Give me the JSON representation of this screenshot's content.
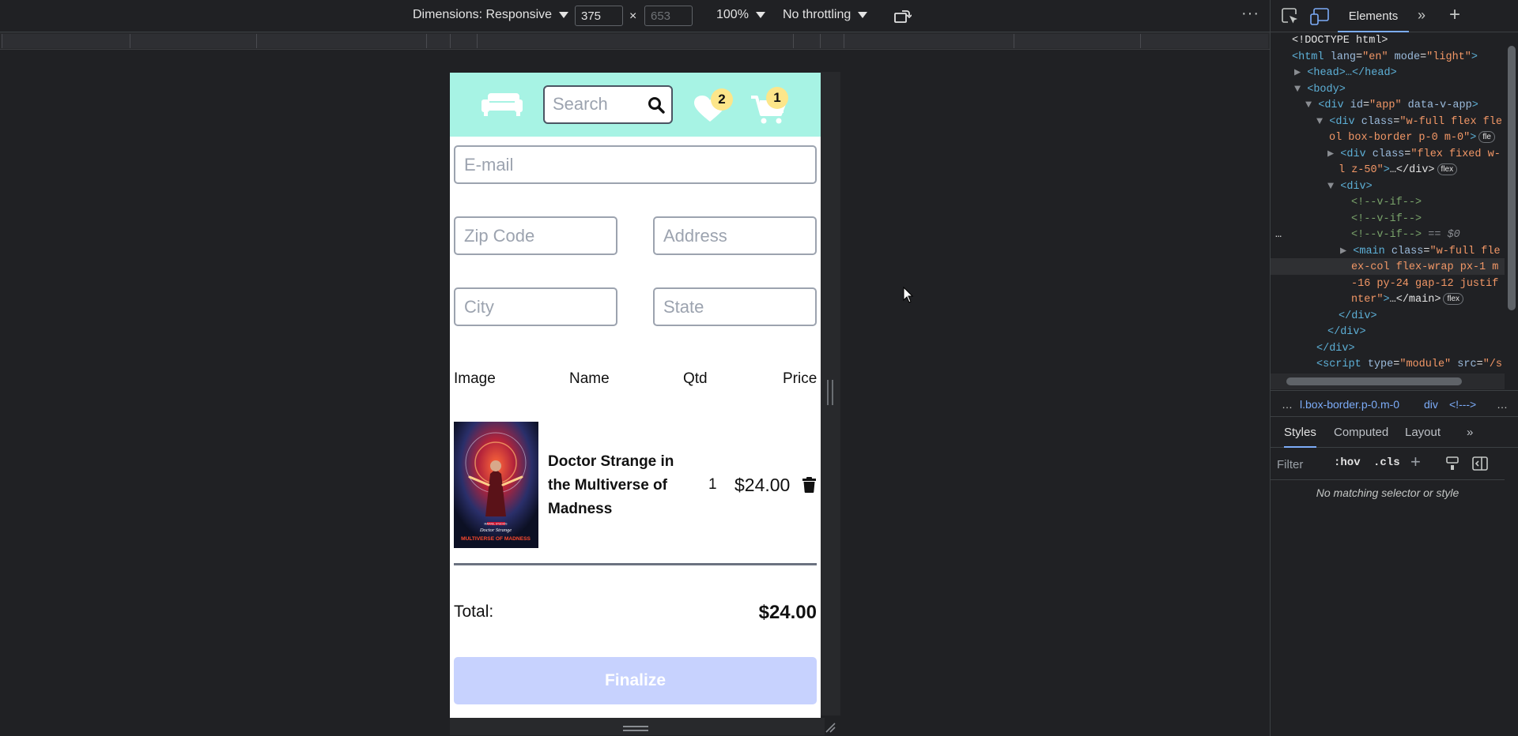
{
  "devbar": {
    "dimensions_label": "Dimensions: Responsive",
    "width": "375",
    "height": "653",
    "zoom": "100%",
    "throttling": "No throttling",
    "more": "⋮"
  },
  "app": {
    "search_placeholder": "Search",
    "wishlist_count": "2",
    "cart_count": "1",
    "form": {
      "email_placeholder": "E-mail",
      "zip_placeholder": "Zip Code",
      "address_placeholder": "Address",
      "city_placeholder": "City",
      "state_placeholder": "State"
    },
    "table_headers": [
      "Image",
      "Name",
      "Qtd",
      "Price"
    ],
    "cart_items": [
      {
        "name": "Doctor Strange in the Multiverse of Madness",
        "qtd": "1",
        "price": "$24.00",
        "poster_text": {
          "brand": "MARVEL STUDIOS",
          "title_top": "Doctor Strange",
          "title_bottom": "MULTIVERSE OF MADNESS"
        }
      }
    ],
    "total_label": "Total:",
    "total_value": "$24.00",
    "finalize_label": "Finalize"
  },
  "devtools": {
    "tab_elements": "Elements",
    "more_tabs": "»",
    "new_tab": "+",
    "breadcrumbs": [
      "…",
      "l.box-border.p-0.m-0",
      "div",
      "<!--->",
      "…"
    ],
    "styles_tabs": [
      "Styles",
      "Computed",
      "Layout",
      "»"
    ],
    "filter_placeholder": "Filter",
    "hov": ":hov",
    "cls": ".cls",
    "no_match": "No matching selector or style",
    "dom": {
      "doctype": "<!DOCTYPE html>",
      "html_tag": "<html",
      "html_attr1": "lang",
      "html_val1": "\"en\"",
      "html_attr2": "mode",
      "html_val2": "\"light\"",
      "head": "<head>…</head>",
      "body": "<body>",
      "app_div": "<div",
      "app_attr1": "id",
      "app_val1": "\"app\"",
      "app_attr2": "data-v-app",
      "div1": "<div",
      "div1_attr": "class",
      "div1_val_a": "\"w-full flex fle",
      "div1_val_b": "ol box-border p-0 m-0\"",
      "div1_badge": "fle",
      "div2": "<div",
      "div2_attr": "class",
      "div2_val_a": "\"flex fixed w-",
      "div2_val_b": "l z-50\"",
      "div2_rest": "…</div>",
      "badge_flex": "flex",
      "div3": "<div>",
      "comment": "<!--v-if-->",
      "selected_marker": "== $0",
      "main_tag": "<main",
      "main_attr": "class",
      "main_val_a": "\"w-full fle",
      "main_val_b": "ex-col flex-wrap px-1 m",
      "main_val_c": "-16 py-24 gap-12 justif",
      "main_val_d": "nter\"",
      "main_rest": "…</main>",
      "close_div": "</div>",
      "script_tag": "<script",
      "script_attr1": "type",
      "script_val1": "\"module\"",
      "script_attr2": "src",
      "script_val2": "\"/s",
      "row_ellipsis": "…"
    }
  },
  "colors": {
    "header_bg": "#a7f3e4",
    "badge_bg": "#fde68a",
    "finalize_bg": "#c7d2fe",
    "devtools_bg": "#202124",
    "accent": "#7cacf8"
  }
}
